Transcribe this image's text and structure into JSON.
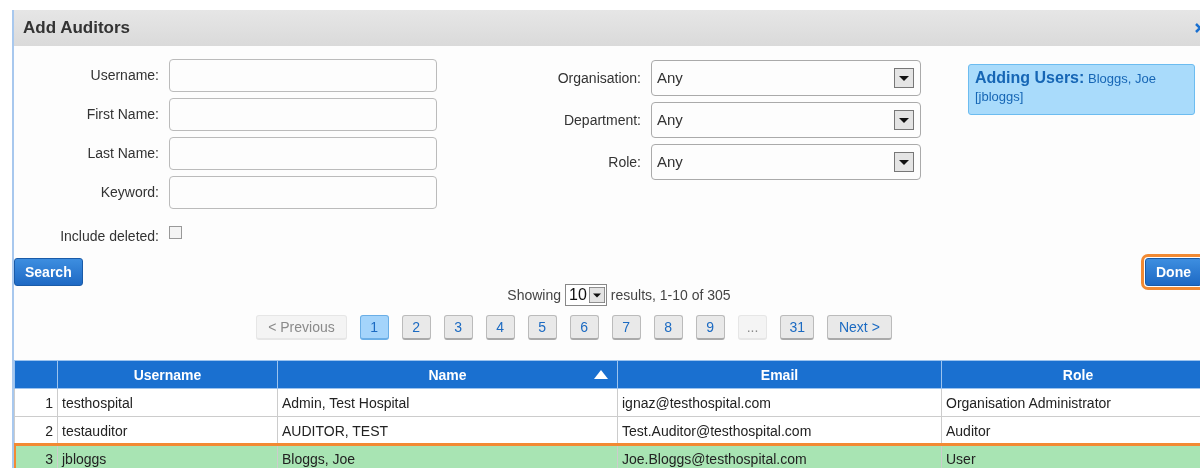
{
  "dialog": {
    "title": "Add Auditors"
  },
  "form": {
    "text_fields": [
      {
        "label": "Username:"
      },
      {
        "label": "First Name:"
      },
      {
        "label": "Last Name:"
      },
      {
        "label": "Keyword:"
      }
    ],
    "checkbox": {
      "label": "Include deleted:",
      "checked": false
    },
    "selects": [
      {
        "label": "Organisation:",
        "value": "Any"
      },
      {
        "label": "Department:",
        "value": "Any"
      },
      {
        "label": "Role:",
        "value": "Any"
      }
    ],
    "adding": {
      "label": "Adding Users:",
      "value": "Bloggs, Joe [jbloggs]"
    }
  },
  "search_button": "Search",
  "done_button": {
    "label": "Done",
    "highlighted": true
  },
  "paging": {
    "showing_label": "Showing",
    "page_size": "10",
    "results_text": "results, 1-10 of 305",
    "pages": [
      {
        "label": "< Previous",
        "disabled": true,
        "selected": false
      },
      {
        "label": "1",
        "disabled": false,
        "selected": true
      },
      {
        "label": "2",
        "disabled": false,
        "selected": false
      },
      {
        "label": "3",
        "disabled": false,
        "selected": false
      },
      {
        "label": "4",
        "disabled": false,
        "selected": false
      },
      {
        "label": "5",
        "disabled": false,
        "selected": false
      },
      {
        "label": "6",
        "disabled": false,
        "selected": false
      },
      {
        "label": "7",
        "disabled": false,
        "selected": false
      },
      {
        "label": "8",
        "disabled": false,
        "selected": false
      },
      {
        "label": "9",
        "disabled": false,
        "selected": false
      },
      {
        "label": "...",
        "disabled": true,
        "selected": false
      },
      {
        "label": "31",
        "disabled": false,
        "selected": false
      },
      {
        "label": "Next >",
        "disabled": false,
        "selected": false
      }
    ]
  },
  "table": {
    "columns": [
      {
        "label": "Username",
        "sorted": false
      },
      {
        "label": "Name",
        "sorted": true
      },
      {
        "label": "Email",
        "sorted": false
      },
      {
        "label": "Role",
        "sorted": false
      }
    ],
    "rows": [
      {
        "index": "1",
        "cells": [
          "testhospital",
          "Admin, Test Hospital",
          "ignaz@testhospital.com",
          "Organisation Administrator"
        ],
        "selected": false
      },
      {
        "index": "2",
        "cells": [
          "testauditor",
          "AUDITOR, TEST",
          "Test.Auditor@testhospital.com",
          "Auditor"
        ],
        "selected": false
      },
      {
        "index": "3",
        "cells": [
          "jbloggs",
          "Bloggs, Joe",
          "Joe.Bloggs@testhospital.com",
          "User"
        ],
        "selected": true
      }
    ]
  }
}
